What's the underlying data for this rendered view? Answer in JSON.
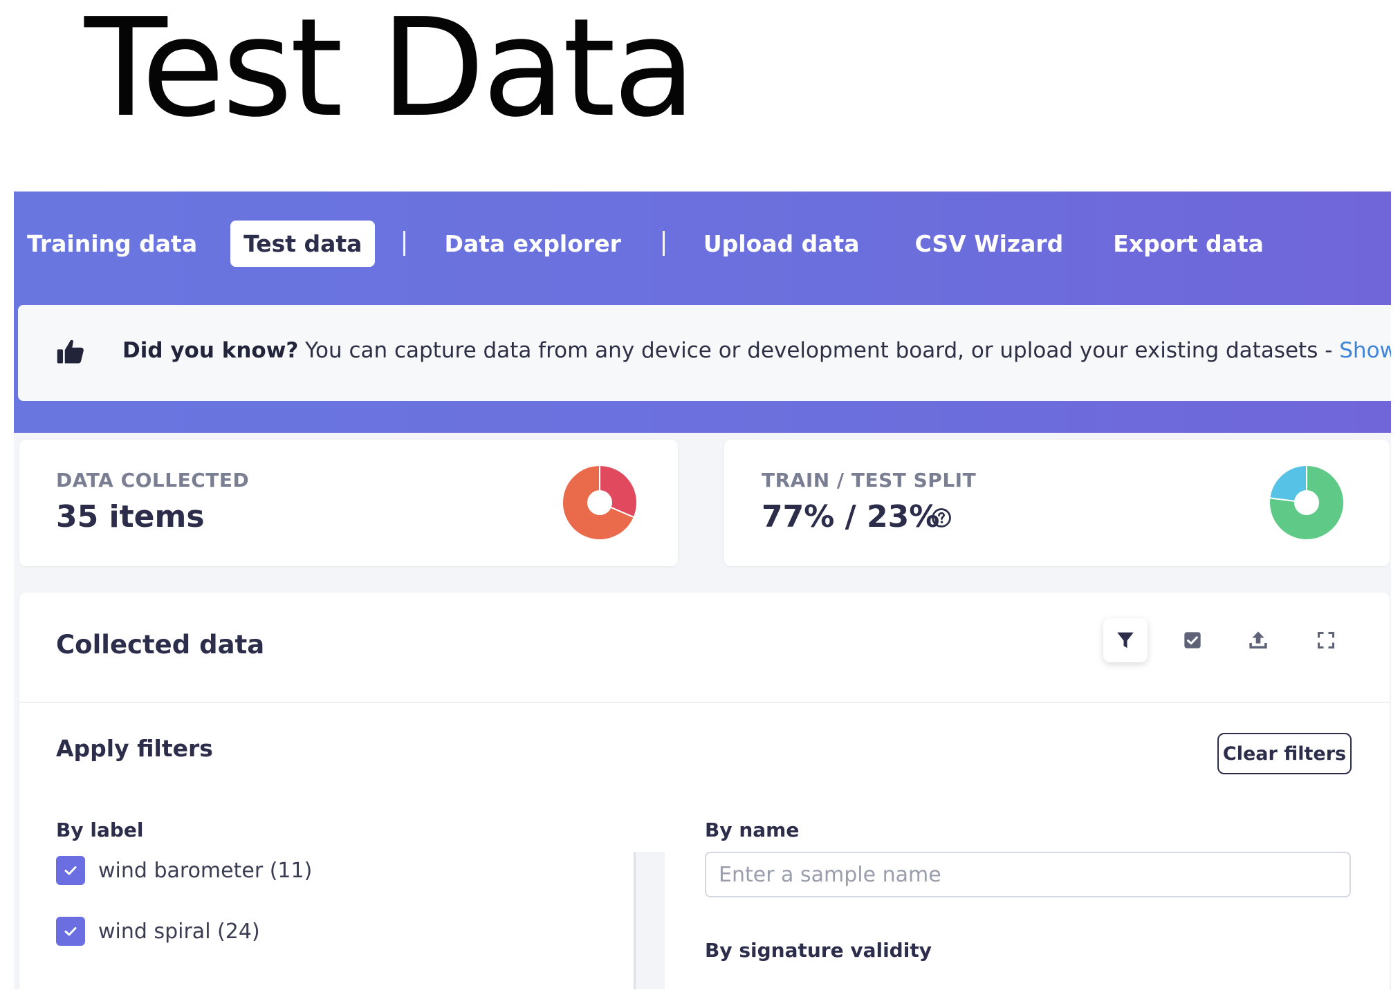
{
  "heading": "Test Data",
  "tabs": [
    {
      "label": "Training data",
      "active": false
    },
    {
      "label": "Test data",
      "active": true
    },
    {
      "label": "Data explorer",
      "active": false
    },
    {
      "label": "Upload data",
      "active": false
    },
    {
      "label": "CSV Wizard",
      "active": false
    },
    {
      "label": "Export data",
      "active": false
    }
  ],
  "tip": {
    "icon": "thumbs-up-icon",
    "bold": "Did you know?",
    "text": " You can capture data from any device or development board, or upload your existing datasets - ",
    "link": "Show options"
  },
  "stats": {
    "data_collected": {
      "label": "DATA COLLECTED",
      "value": "35 items",
      "donut": {
        "segments": [
          {
            "label": "wind barometer",
            "value": 11,
            "color": "#e0495e"
          },
          {
            "label": "wind spiral",
            "value": 24,
            "color": "#ea6b4c"
          }
        ]
      }
    },
    "train_test_split": {
      "label": "TRAIN / TEST SPLIT",
      "value": "77% / 23%",
      "help_icon": "question-circle-icon",
      "donut": {
        "segments": [
          {
            "label": "train",
            "value": 77,
            "color": "#5fca88"
          },
          {
            "label": "test",
            "value": 23,
            "color": "#56c2e6"
          }
        ]
      }
    }
  },
  "collected": {
    "title": "Collected data",
    "tools": [
      "filter-icon",
      "check-square-icon",
      "upload-icon",
      "expand-icon"
    ]
  },
  "filters": {
    "title": "Apply filters",
    "clear_label": "Clear filters",
    "by_label": "By label",
    "labels": [
      {
        "text": "wind barometer (11)",
        "checked": true
      },
      {
        "text": "wind spiral (24)",
        "checked": true
      }
    ],
    "by_name": "By name",
    "name_placeholder": "Enter a sample name",
    "name_value": "",
    "by_signature": "By signature validity"
  }
}
